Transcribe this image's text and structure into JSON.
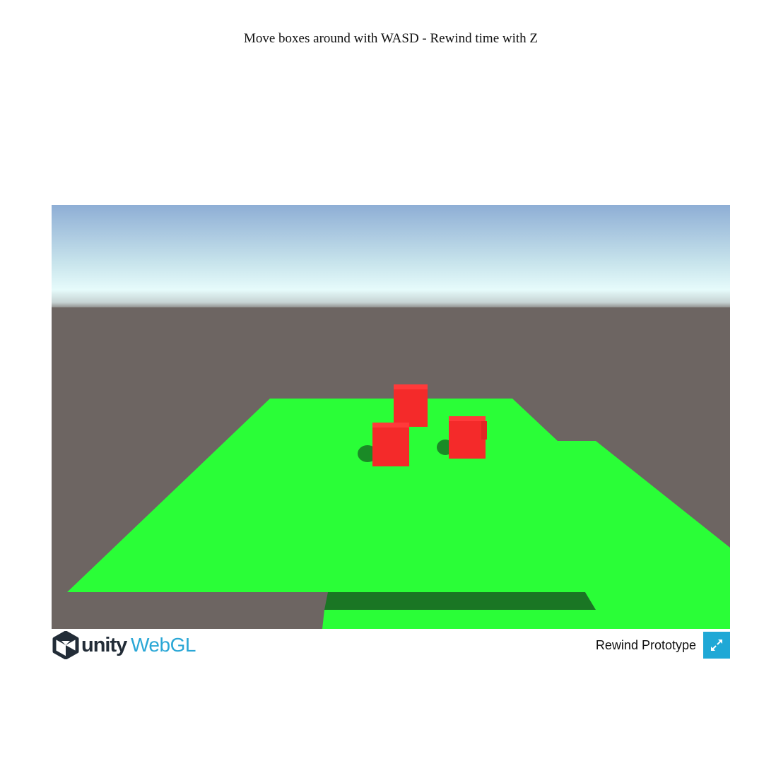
{
  "instructions": "Move boxes around with WASD - Rewind time with Z",
  "footer": {
    "logo_unity": "unity",
    "logo_webgl": "WebGL",
    "title": "Rewind Prototype",
    "fullscreen_icon": "fullscreen-icon"
  },
  "scene": {
    "sky_colors": [
      "#8eaed5",
      "#dff8f8",
      "#6d6562"
    ],
    "ground_color": "#6d6562",
    "platform_color": "#2afe37",
    "shadow_color": "#1a7624",
    "box_color": "#f42a2a",
    "box_count": 3
  }
}
